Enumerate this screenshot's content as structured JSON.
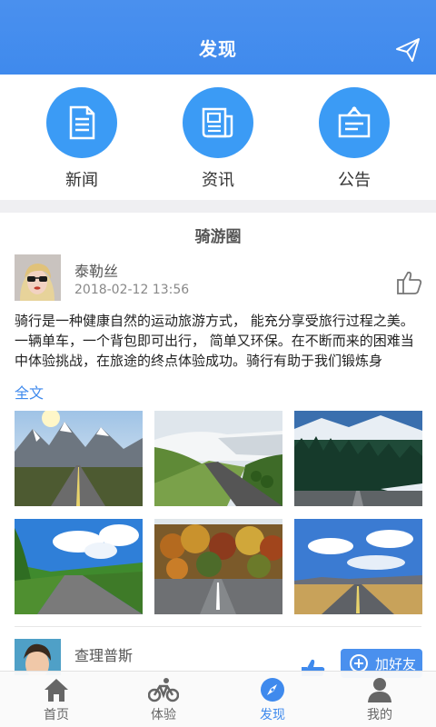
{
  "header": {
    "title": "发现"
  },
  "categories": [
    {
      "label": "新闻",
      "icon": "document-icon"
    },
    {
      "label": "资讯",
      "icon": "newspaper-icon"
    },
    {
      "label": "公告",
      "icon": "notice-board-icon"
    }
  ],
  "section": {
    "title": "骑游圈"
  },
  "post": {
    "user": "泰勒丝",
    "time": "2018-02-12 13:56",
    "text": "骑行是一种健康自然的运动旅游方式， 能充分享受旅行过程之美。一辆单车，一个背包即可出行， 简单又环保。在不断而来的困难当中体验挑战，在旅途的终点体验成功。骑行有助于我们锻炼身",
    "more": "全文"
  },
  "post2": {
    "user": "查理普斯",
    "add_friend": "加好友"
  },
  "tabs": [
    {
      "label": "首页",
      "icon": "home-icon",
      "active": false
    },
    {
      "label": "体验",
      "icon": "bicycle-icon",
      "active": false
    },
    {
      "label": "发现",
      "icon": "compass-icon",
      "active": true
    },
    {
      "label": "我的",
      "icon": "user-icon",
      "active": false
    }
  ],
  "colors": {
    "primary": "#3f8aed",
    "icon_circle": "#3b9bf5"
  }
}
